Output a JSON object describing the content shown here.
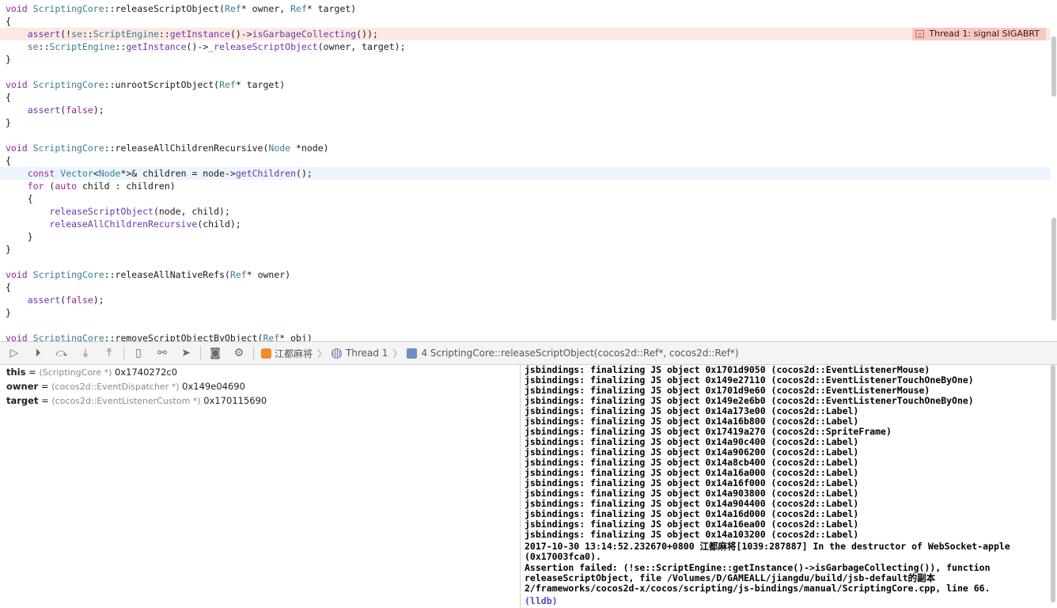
{
  "editor": {
    "lines": [
      {
        "type": "fn-sig",
        "cls": "ScriptingCore",
        "method": "releaseScriptObject",
        "params": [
          {
            "type": "Ref",
            "name": "* owner"
          },
          {
            "type": "Ref",
            "name": "* target"
          }
        ]
      },
      {
        "type": "plain",
        "text": "{"
      },
      {
        "type": "raw",
        "style": "error",
        "html_parts": [
          [
            "",
            "    "
          ],
          [
            "fn",
            "assert"
          ],
          [
            "",
            "(!"
          ],
          [
            "ty",
            "se"
          ],
          [
            "",
            "::"
          ],
          [
            "ty",
            "ScriptEngine"
          ],
          [
            "",
            "::"
          ],
          [
            "fn",
            "getInstance"
          ],
          [
            "",
            "()->"
          ],
          [
            "fn",
            "isGarbageCollecting"
          ],
          [
            "",
            "());"
          ]
        ]
      },
      {
        "type": "raw",
        "html_parts": [
          [
            "",
            "    "
          ],
          [
            "ty",
            "se"
          ],
          [
            "",
            "::"
          ],
          [
            "ty",
            "ScriptEngine"
          ],
          [
            "",
            "::"
          ],
          [
            "fn",
            "getInstance"
          ],
          [
            "",
            "()->"
          ],
          [
            "fn",
            "_releaseScriptObject"
          ],
          [
            "",
            "(owner, target);"
          ]
        ]
      },
      {
        "type": "plain",
        "text": "}"
      },
      {
        "type": "plain",
        "text": ""
      },
      {
        "type": "fn-sig",
        "cls": "ScriptingCore",
        "method": "unrootScriptObject",
        "params": [
          {
            "type": "Ref",
            "name": "* target"
          }
        ]
      },
      {
        "type": "plain",
        "text": "{"
      },
      {
        "type": "raw",
        "html_parts": [
          [
            "",
            "    "
          ],
          [
            "fn",
            "assert"
          ],
          [
            "",
            "("
          ],
          [
            "kw",
            "false"
          ],
          [
            "",
            ");"
          ]
        ]
      },
      {
        "type": "plain",
        "text": "}"
      },
      {
        "type": "plain",
        "text": ""
      },
      {
        "type": "fn-sig",
        "cls": "ScriptingCore",
        "method": "releaseAllChildrenRecursive",
        "params": [
          {
            "type": "Node",
            "name": " *node"
          }
        ]
      },
      {
        "type": "plain",
        "text": "{"
      },
      {
        "type": "raw",
        "style": "current",
        "html_parts": [
          [
            "",
            "    "
          ],
          [
            "kw",
            "const"
          ],
          [
            "",
            " "
          ],
          [
            "ty",
            "Vector"
          ],
          [
            "",
            "<"
          ],
          [
            "ty",
            "Node"
          ],
          [
            "",
            "*>& children = node->"
          ],
          [
            "fn",
            "getChildren"
          ],
          [
            "",
            "();"
          ]
        ]
      },
      {
        "type": "raw",
        "html_parts": [
          [
            "",
            "    "
          ],
          [
            "kw",
            "for"
          ],
          [
            "",
            " ("
          ],
          [
            "kw",
            "auto"
          ],
          [
            "",
            " child : children)"
          ]
        ]
      },
      {
        "type": "plain",
        "text": "    {"
      },
      {
        "type": "raw",
        "html_parts": [
          [
            "",
            "        "
          ],
          [
            "fn",
            "releaseScriptObject"
          ],
          [
            "",
            "(node, child);"
          ]
        ]
      },
      {
        "type": "raw",
        "html_parts": [
          [
            "",
            "        "
          ],
          [
            "fn",
            "releaseAllChildrenRecursive"
          ],
          [
            "",
            "(child);"
          ]
        ]
      },
      {
        "type": "plain",
        "text": "    }"
      },
      {
        "type": "plain",
        "text": "}"
      },
      {
        "type": "plain",
        "text": ""
      },
      {
        "type": "fn-sig",
        "cls": "ScriptingCore",
        "method": "releaseAllNativeRefs",
        "params": [
          {
            "type": "Ref",
            "name": "* owner"
          }
        ]
      },
      {
        "type": "plain",
        "text": "{"
      },
      {
        "type": "raw",
        "html_parts": [
          [
            "",
            "    "
          ],
          [
            "fn",
            "assert"
          ],
          [
            "",
            "("
          ],
          [
            "kw",
            "false"
          ],
          [
            "",
            ");"
          ]
        ]
      },
      {
        "type": "plain",
        "text": "}"
      },
      {
        "type": "plain",
        "text": ""
      },
      {
        "type": "fn-sig",
        "cls": "ScriptingCore",
        "method": "removeScriptObjectByObject",
        "params": [
          {
            "type": "Ref",
            "name": "* obj"
          }
        ]
      }
    ],
    "error_badge": "Thread 1: signal SIGABRT"
  },
  "debugbar": {
    "buttons": [
      {
        "name": "breakpoints-toggle-button",
        "glyph": "▷"
      },
      {
        "name": "continue-button",
        "glyph": "⏵"
      },
      {
        "name": "step-over-button",
        "glyph": "⤼"
      },
      {
        "name": "step-into-button",
        "glyph": "⤓"
      },
      {
        "name": "step-out-button",
        "glyph": "⤒"
      },
      {
        "name": "debug-view-hierarchy-button",
        "glyph": "▯"
      },
      {
        "name": "memory-graph-button",
        "glyph": "⚯"
      },
      {
        "name": "simulate-location-button",
        "glyph": "➤"
      },
      {
        "name": "camera-button",
        "glyph": "◙"
      },
      {
        "name": "environment-overrides-button",
        "glyph": "⚙"
      }
    ],
    "breadcrumb": {
      "app": "江都麻将",
      "thread": "Thread 1",
      "frame": "4 ScriptingCore::releaseScriptObject(cocos2d::Ref*, cocos2d::Ref*)"
    }
  },
  "variables": [
    {
      "name": "this",
      "type": "(ScriptingCore *)",
      "value": "0x1740272c0"
    },
    {
      "name": "owner",
      "type": "(cocos2d::EventDispatcher *)",
      "value": "0x149e04690"
    },
    {
      "name": "target",
      "type": "(cocos2d::EventListenerCustom *)",
      "value": "0x170115690"
    }
  ],
  "console": {
    "lines": [
      "jsbindings: finalizing JS object 0x1701d9050 (cocos2d::EventListenerMouse)",
      "jsbindings: finalizing JS object 0x149e27110 (cocos2d::EventListenerTouchOneByOne)",
      "jsbindings: finalizing JS object 0x1701d9e60 (cocos2d::EventListenerMouse)",
      "jsbindings: finalizing JS object 0x149e2e6b0 (cocos2d::EventListenerTouchOneByOne)",
      "jsbindings: finalizing JS object 0x14a173e00 (cocos2d::Label)",
      "jsbindings: finalizing JS object 0x14a16b800 (cocos2d::Label)",
      "jsbindings: finalizing JS object 0x17419a270 (cocos2d::SpriteFrame)",
      "jsbindings: finalizing JS object 0x14a90c400 (cocos2d::Label)",
      "jsbindings: finalizing JS object 0x14a906200 (cocos2d::Label)",
      "jsbindings: finalizing JS object 0x14a8cb400 (cocos2d::Label)",
      "jsbindings: finalizing JS object 0x14a16a000 (cocos2d::Label)",
      "jsbindings: finalizing JS object 0x14a16f000 (cocos2d::Label)",
      "jsbindings: finalizing JS object 0x14a903800 (cocos2d::Label)",
      "jsbindings: finalizing JS object 0x14a904400 (cocos2d::Label)",
      "jsbindings: finalizing JS object 0x14a16d000 (cocos2d::Label)",
      "jsbindings: finalizing JS object 0x14a16ea00 (cocos2d::Label)",
      "jsbindings: finalizing JS object 0x14a103200 (cocos2d::Label)"
    ],
    "destructor_msg": "2017-10-30 13:14:52.232670+0800 江都麻将[1039:287887] In the destructor of WebSocket-apple (0x17003fca0).",
    "assert_msg": "Assertion failed: (!se::ScriptEngine::getInstance()->isGarbageCollecting()), function releaseScriptObject, file /Volumes/D/GAMEALL/jiangdu/build/jsb-default的副本 2/frameworks/cocos2d-x/cocos/scripting/js-bindings/manual/ScriptingCore.cpp, line 66.",
    "prompt": "(lldb)"
  }
}
